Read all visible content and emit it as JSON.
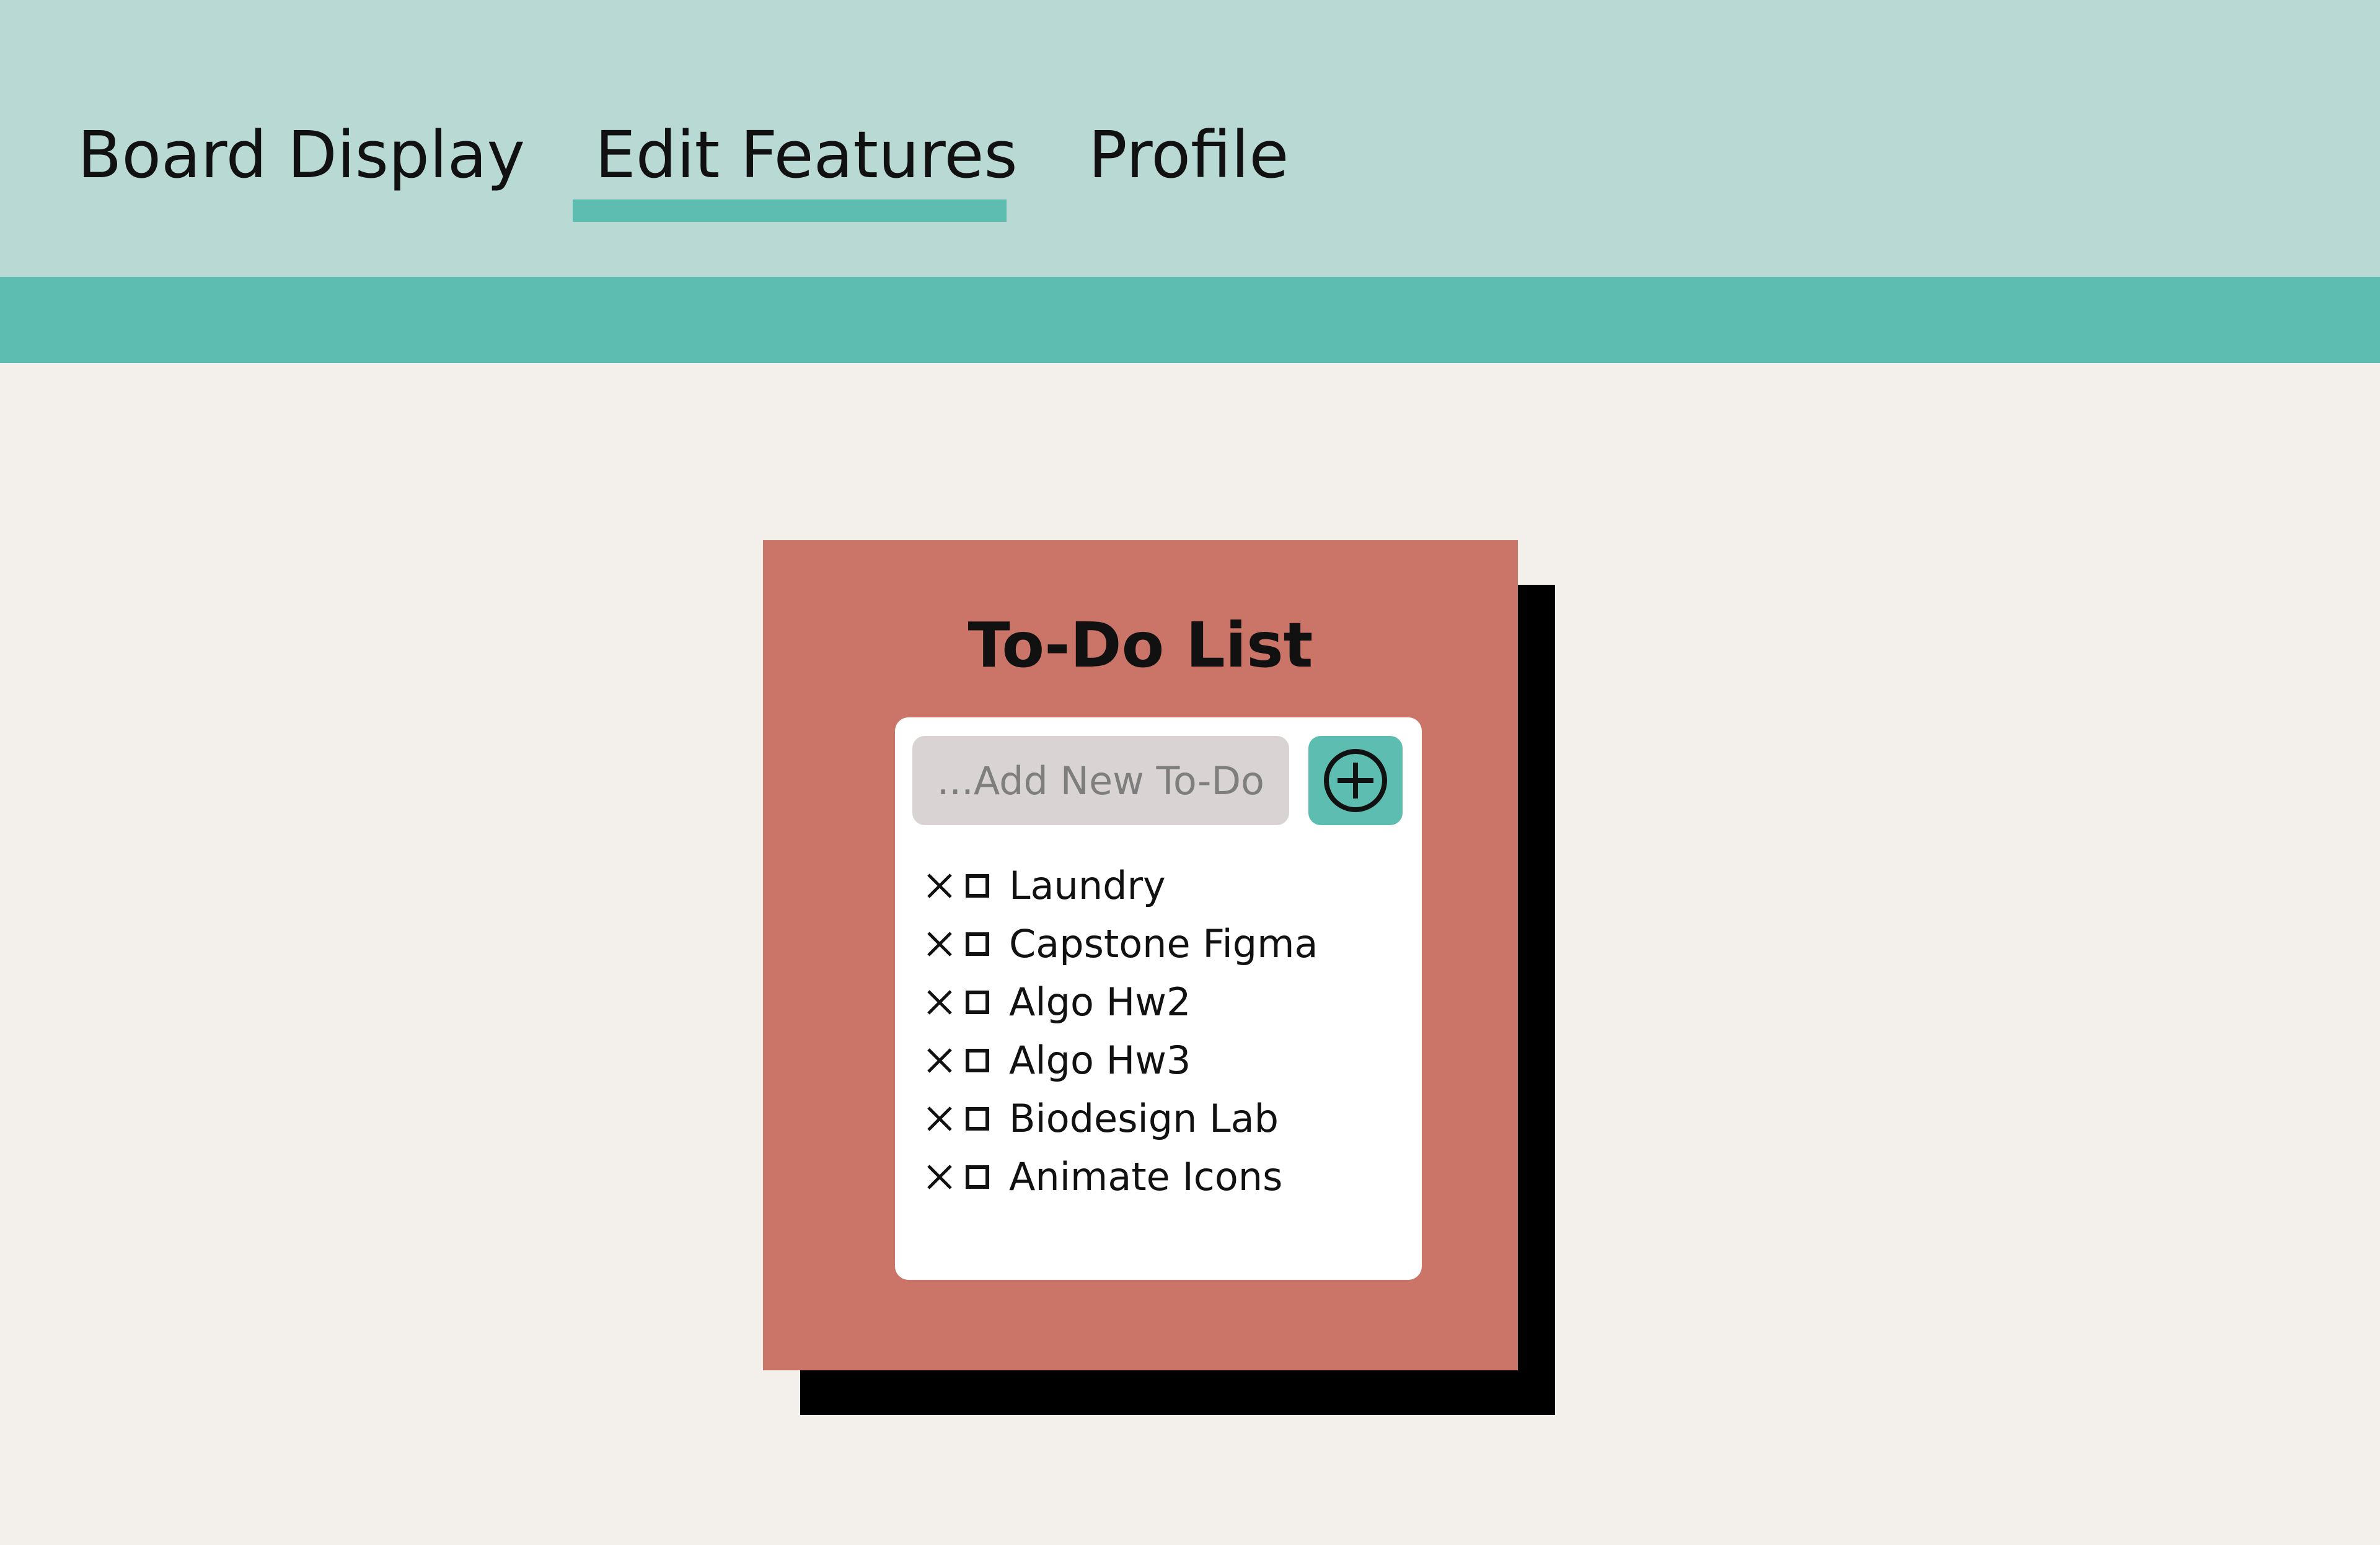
{
  "nav": {
    "tabs": [
      {
        "label": "Board Display"
      },
      {
        "label": "Edit Features",
        "active": true
      },
      {
        "label": "Profile"
      }
    ],
    "colors": {
      "background": "#b9d9d4",
      "accent": "#5cbdb0"
    }
  },
  "todo_card": {
    "title": "To-Do List",
    "input": {
      "placeholder": "...Add New To-Do",
      "value": ""
    },
    "add_button_icon": "plus-circle-icon",
    "items": [
      {
        "label": "Laundry",
        "checked": false
      },
      {
        "label": "Capstone Figma",
        "checked": false
      },
      {
        "label": "Algo Hw2",
        "checked": false
      },
      {
        "label": "Algo Hw3",
        "checked": false
      },
      {
        "label": "Biodesign Lab",
        "checked": false
      },
      {
        "label": "Animate Icons",
        "checked": false
      }
    ],
    "item_icons": {
      "delete": "close-icon",
      "check": "checkbox-icon"
    },
    "colors": {
      "card": "#cb7569",
      "shadow": "#000000",
      "panel": "#ffffff",
      "input": "#d9d4d3",
      "button": "#5cbdb0"
    }
  }
}
